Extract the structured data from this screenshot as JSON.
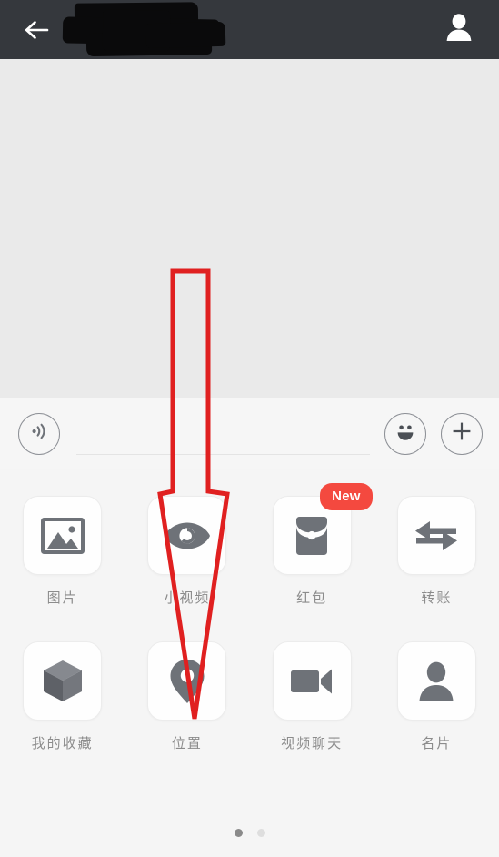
{
  "header": {
    "back_icon": "back-arrow-icon",
    "title": "",
    "title_state": "redacted",
    "contact_icon": "contact-person-icon",
    "background_color": "#35383d"
  },
  "chat": {
    "messages": [],
    "background_color": "#eaeaea"
  },
  "input_bar": {
    "voice_icon": "voice-wave-icon",
    "input_value": "",
    "input_placeholder": "",
    "emoji_icon": "smiley-face-icon",
    "plus_icon": "plus-icon"
  },
  "panel": {
    "rows": [
      [
        {
          "label": "图片",
          "icon": "image-icon",
          "badge": null
        },
        {
          "label": "小视频",
          "icon": "eye-icon",
          "badge": null
        },
        {
          "label": "红包",
          "icon": "red-packet-icon",
          "badge": "New"
        },
        {
          "label": "转账",
          "icon": "transfer-arrows-icon",
          "badge": null
        }
      ],
      [
        {
          "label": "我的收藏",
          "icon": "cube-icon",
          "badge": null
        },
        {
          "label": "位置",
          "icon": "location-pin-icon",
          "badge": null
        },
        {
          "label": "视频聊天",
          "icon": "video-camera-icon",
          "badge": null
        },
        {
          "label": "名片",
          "icon": "person-card-icon",
          "badge": null
        }
      ]
    ],
    "page_dots": {
      "count": 2,
      "active_index": 0
    }
  },
  "annotation": {
    "type": "arrow",
    "color": "#e02020",
    "points_to": "位置",
    "description": "red outlined arrow pointing down at the location tile"
  },
  "colors": {
    "header": "#35383d",
    "chat_background": "#eaeaea",
    "panel_background": "#f5f5f5",
    "tile": "#fefefe",
    "icon_gray": "#6e7278",
    "label_gray": "#8c8c8c",
    "badge_red": "#f4493f",
    "annotation_red": "#e02020"
  }
}
